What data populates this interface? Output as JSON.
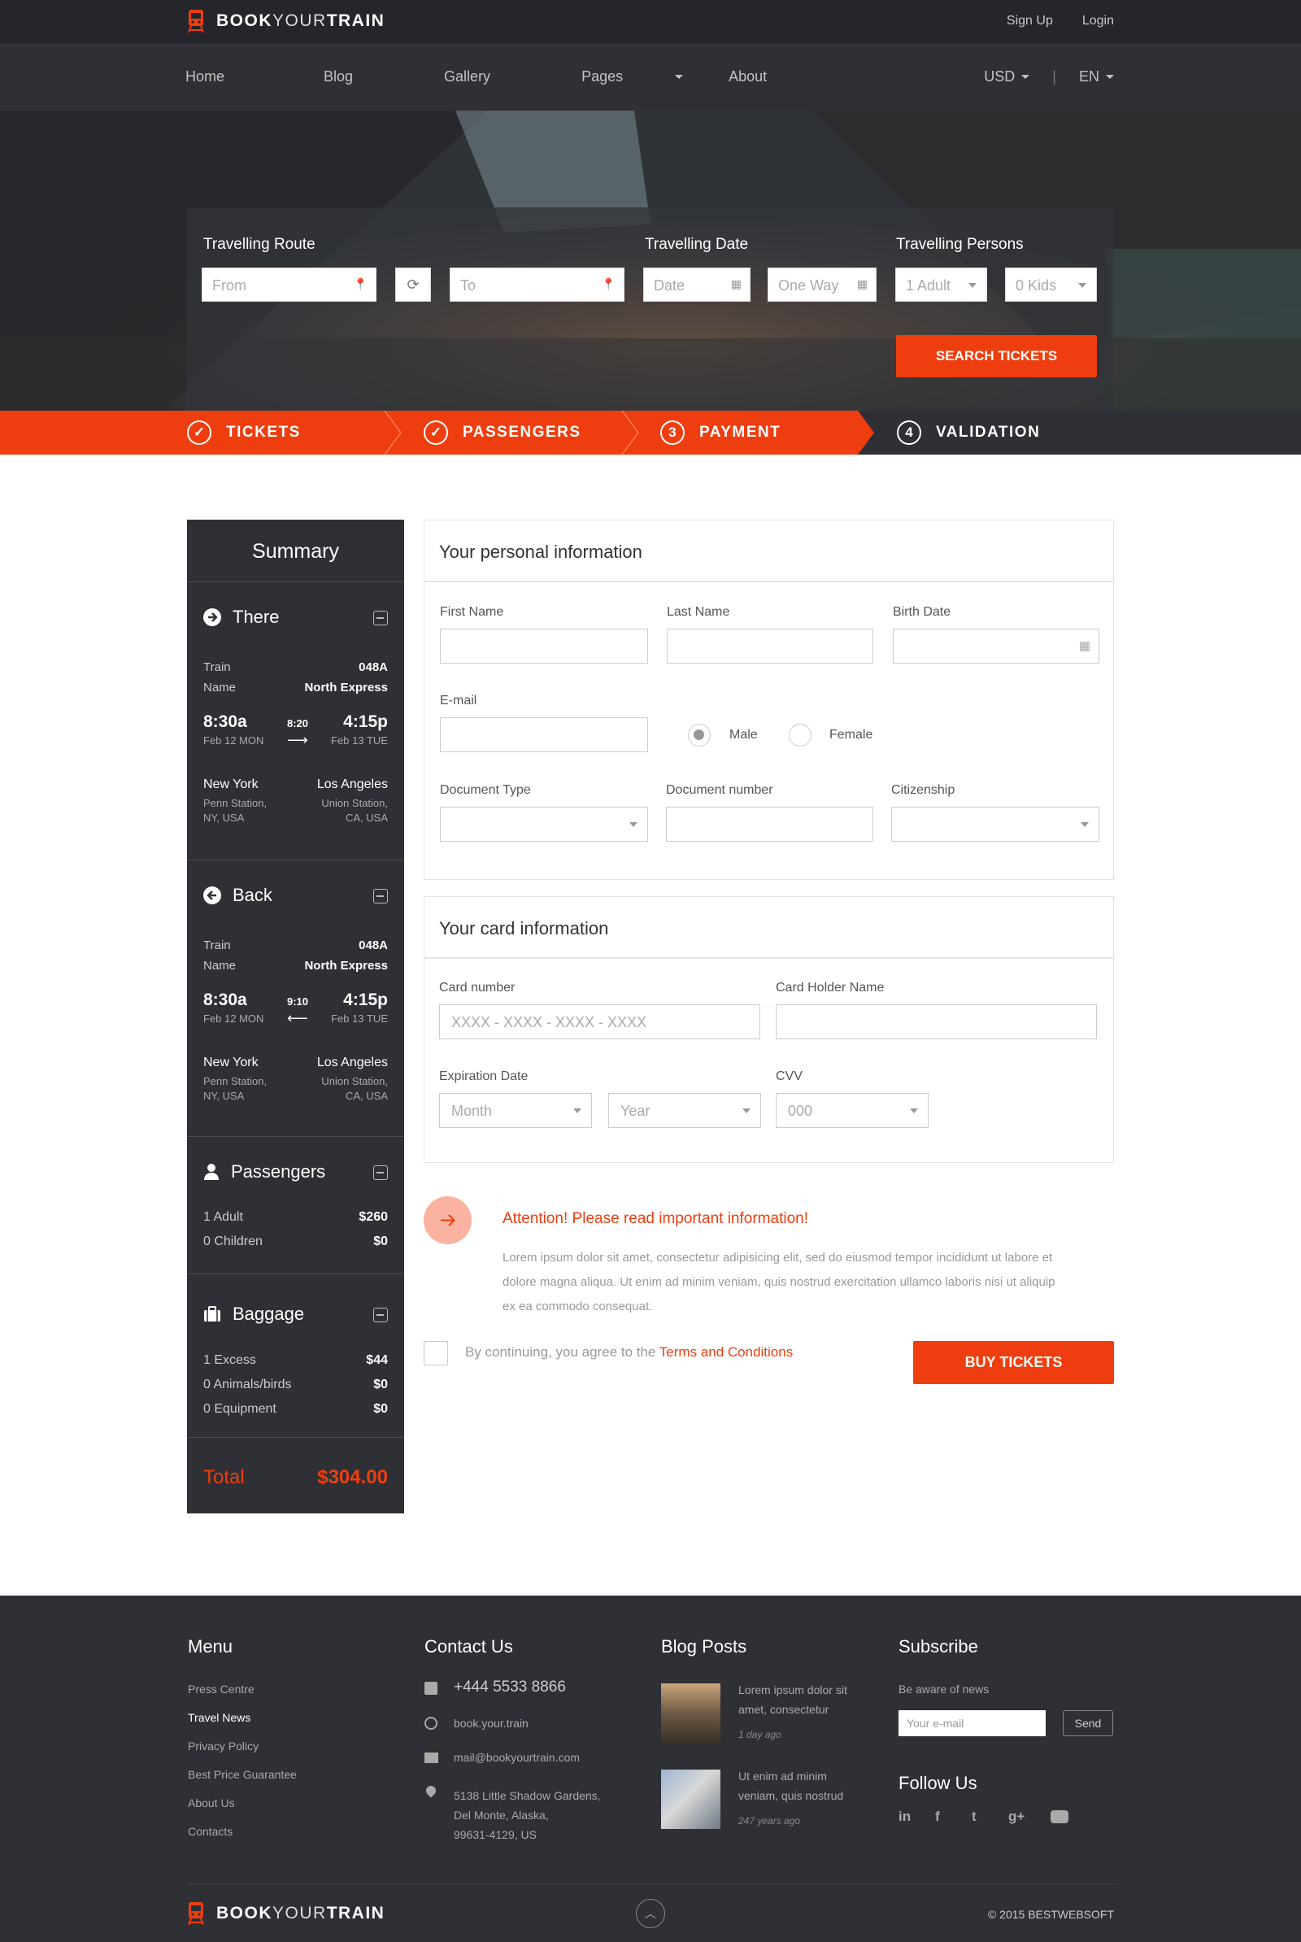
{
  "brand": {
    "logo_bold": "BOOK",
    "logo_light": "YOUR",
    "logo_end": "TRAIN"
  },
  "topbar": {
    "signup": "Sign Up",
    "login": "Login"
  },
  "nav": {
    "items": [
      "Home",
      "Blog",
      "Gallery",
      "Pages",
      "About"
    ],
    "currency": "USD",
    "divider": "|",
    "language": "EN"
  },
  "search": {
    "route_label": "Travelling Route",
    "date_label": "Travelling Date",
    "persons_label": "Travelling Persons",
    "from_placeholder": "From",
    "to_placeholder": "To",
    "date_placeholder": "Date",
    "way_value": "One Way",
    "adults_value": "1 Adult",
    "kids_value": "0 Kids",
    "button": "SEARCH TICKETS"
  },
  "steps": [
    {
      "label": "TICKETS",
      "num": "✓"
    },
    {
      "label": "PASSENGERS",
      "num": "✓"
    },
    {
      "label": "PAYMENT",
      "num": "3"
    },
    {
      "label": "VALIDATION",
      "num": "4"
    }
  ],
  "summary": {
    "title": "Summary",
    "there": {
      "title": "There",
      "train_label": "Train",
      "train_value": "048A",
      "name_label": "Name",
      "name_value": "North Express",
      "dep_time": "8:30a",
      "dep_date": "Feb 12 MON",
      "duration": "8:20",
      "arr_time": "4:15p",
      "arr_date": "Feb 13 TUE",
      "from_city": "New York",
      "from_station": "Penn Station,",
      "from_region": "NY, USA",
      "to_city": "Los Angeles",
      "to_station": "Union Station,",
      "to_region": "CA, USA"
    },
    "back": {
      "title": "Back",
      "train_label": "Train",
      "train_value": "048A",
      "name_label": "Name",
      "name_value": "North Express",
      "dep_time": "8:30a",
      "dep_date": "Feb 12 MON",
      "duration": "9:10",
      "arr_time": "4:15p",
      "arr_date": "Feb 13 TUE",
      "from_city": "New York",
      "from_station": "Penn Station,",
      "from_region": "NY, USA",
      "to_city": "Los Angeles",
      "to_station": "Union Station,",
      "to_region": "CA, USA"
    },
    "passengers": {
      "title": "Passengers",
      "rows": [
        {
          "label": "1 Adult",
          "value": "$260"
        },
        {
          "label": "0 Children",
          "value": "$0"
        }
      ]
    },
    "baggage": {
      "title": "Baggage",
      "rows": [
        {
          "label": "1 Excess",
          "value": "$44"
        },
        {
          "label": "0 Animals/birds",
          "value": "$0"
        },
        {
          "label": "0 Equipment",
          "value": "$0"
        }
      ]
    },
    "total_label": "Total",
    "total_value": "$304.00"
  },
  "personal": {
    "title": "Your personal information",
    "first_name": "First Name",
    "last_name": "Last Name",
    "birth_date": "Birth Date",
    "email": "E-mail",
    "male": "Male",
    "female": "Female",
    "doc_type": "Document Type",
    "doc_number": "Document number",
    "citizenship": "Citizenship"
  },
  "card": {
    "title": "Your card information",
    "number_label": "Card number",
    "number_placeholder": "XXXX - XXXX - XXXX - XXXX",
    "holder_label": "Card Holder Name",
    "exp_label": "Expiration Date",
    "month": "Month",
    "year": "Year",
    "cvv_label": "CVV",
    "cvv_value": "000"
  },
  "attention": {
    "title": "Attention! Please read important information!",
    "line1": "Lorem ipsum dolor sit amet, consectetur adipisicing elit, sed do eiusmod tempor incididunt ut labore et",
    "line2": "dolore magna aliqua. Ut enim ad minim veniam, quis nostrud exercitation ullamco laboris nisi ut aliquip",
    "line3": "ex ea commodo consequat."
  },
  "agree": {
    "text": "By continuing, you agree to the ",
    "link": "Terms and Conditions"
  },
  "buy_button": "BUY TICKETS",
  "footer": {
    "menu_title": "Menu",
    "menu": [
      "Press Centre",
      "Travel News",
      "Privacy Policy",
      "Best Price Guarantee",
      "About Us",
      "Contacts"
    ],
    "contact_title": "Contact Us",
    "phone": "+444 5533 8866",
    "skype": "book.your.train",
    "email": "mail@bookyourtrain.com",
    "address1": "5138 Little Shadow Gardens,",
    "address2": "Del Monte, Alaska,",
    "address3": "99631-4129, US",
    "blog_title": "Blog Posts",
    "post1_line1": "Lorem ipsum dolor sit",
    "post1_line2": "amet, consectetur",
    "post1_date": "1 day ago",
    "post2_line1": "Ut enim ad minim",
    "post2_line2": "veniam, quis nostrud",
    "post2_date": "247 years ago",
    "subscribe_title": "Subscribe",
    "subscribe_text": "Be aware of news",
    "email_placeholder": "Your e-mail",
    "send": "Send",
    "follow_title": "Follow Us",
    "copyright": "© 2015 BESTWEBSOFT"
  },
  "colors": {
    "accent": "#ee3e0f",
    "dark": "#2e3035",
    "darker": "#24262b"
  }
}
